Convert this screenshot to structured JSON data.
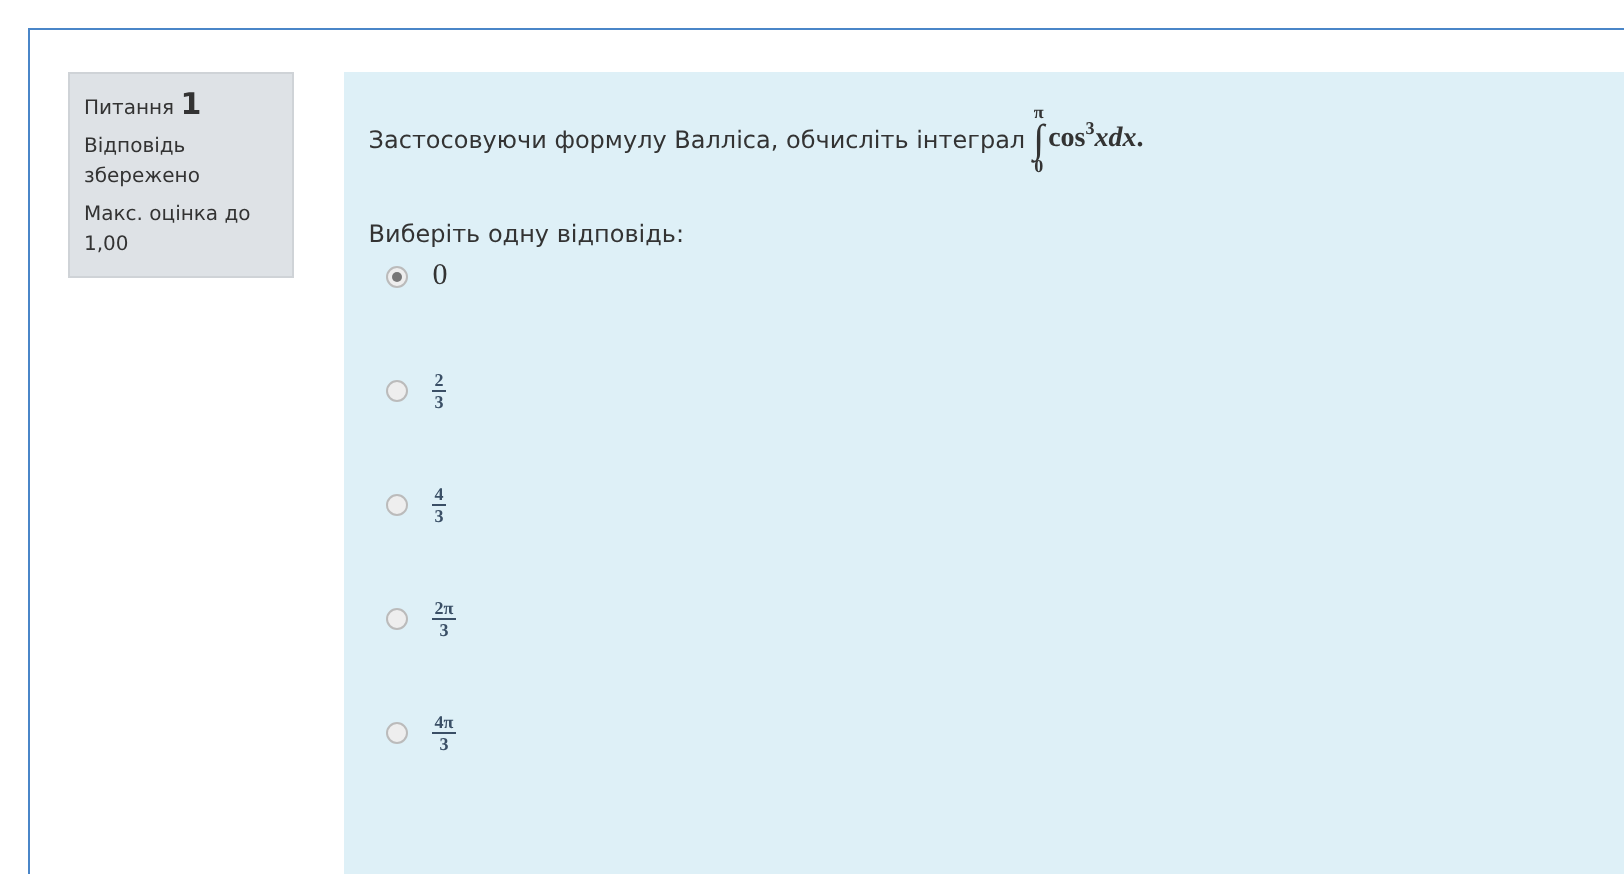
{
  "info": {
    "label": "Питання",
    "number": "1",
    "state": "Відповідь збережено",
    "grade": "Макс. оцінка до 1,00"
  },
  "question": {
    "text": "Застосовуючи формулу Валліса, обчисліть інтеграл",
    "formula": {
      "sign": "∫",
      "lower": "0",
      "upper": "π",
      "func": "cos",
      "power": "3",
      "var": "xdx",
      "end": "."
    },
    "prompt": "Виберіть одну відповідь:",
    "options": [
      {
        "kind": "number",
        "value": "0",
        "selected": true
      },
      {
        "kind": "fraction",
        "numerator": "2",
        "denominator": "3",
        "selected": false
      },
      {
        "kind": "fraction",
        "numerator": "4",
        "denominator": "3",
        "selected": false
      },
      {
        "kind": "fraction",
        "numerator": "2π",
        "denominator": "3",
        "selected": false
      },
      {
        "kind": "fraction",
        "numerator": "4π",
        "denominator": "3",
        "selected": false
      }
    ]
  }
}
